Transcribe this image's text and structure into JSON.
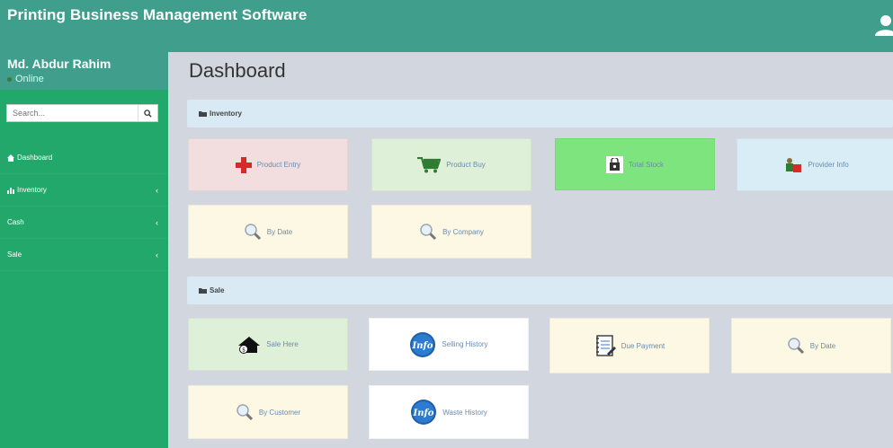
{
  "header": {
    "title": "Printing Business Management Software"
  },
  "sidebar": {
    "user_name": "Md. Abdur Rahim",
    "status": "Online",
    "search_placeholder": "Search...",
    "items": [
      {
        "label": "Dashboard",
        "icon": "home-icon"
      },
      {
        "label": "Inventory",
        "icon": "chart-icon"
      },
      {
        "label": "Cash",
        "icon": ""
      },
      {
        "label": "Sale",
        "icon": ""
      }
    ]
  },
  "main": {
    "title": "Dashboard",
    "inventory_section": {
      "label": "Inventory",
      "tiles": [
        {
          "label": "Product Entry",
          "icon": "plus-icon"
        },
        {
          "label": "Product Buy",
          "icon": "cart-icon"
        },
        {
          "label": "Total Stock",
          "icon": "bag-icon"
        },
        {
          "label": "Provider Info",
          "icon": "person-icon"
        },
        {
          "label": "By Date",
          "icon": "magnifier-icon"
        },
        {
          "label": "By Company",
          "icon": "magnifier-icon"
        }
      ]
    },
    "sale_section": {
      "label": "Sale",
      "tiles": [
        {
          "label": "Sale Here",
          "icon": "house-icon"
        },
        {
          "label": "Selling History",
          "icon": "info-icon"
        },
        {
          "label": "Due Payment",
          "icon": "notepad-icon"
        },
        {
          "label": "By Date",
          "icon": "magnifier-icon"
        },
        {
          "label": "By Customer",
          "icon": "magnifier-icon"
        },
        {
          "label": "Waste History",
          "icon": "info-icon"
        }
      ]
    }
  },
  "colors": {
    "header": "#3f9e8c",
    "sidebar": "#22a86a",
    "content_bg": "#d2d6de",
    "section_bar": "#d9eaf5"
  }
}
